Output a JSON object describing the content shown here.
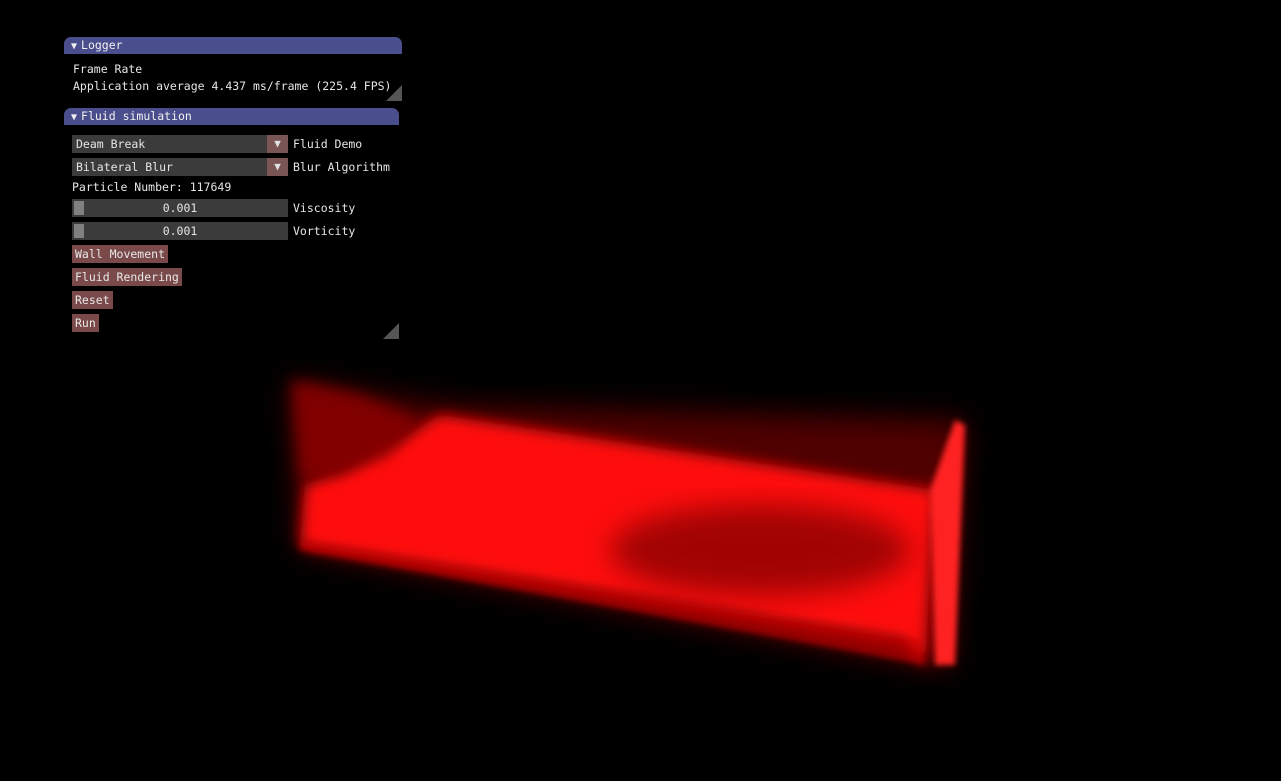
{
  "logger": {
    "title": "Logger",
    "frame_rate_label": "Frame Rate",
    "stats": "Application average 4.437 ms/frame (225.4 FPS)"
  },
  "fluid": {
    "title": "Fluid simulation",
    "demo": {
      "value": "Deam Break",
      "label": "Fluid Demo"
    },
    "blur": {
      "value": "Bilateral Blur",
      "label": "Blur Algorithm"
    },
    "particle_number": "Particle Number: 117649",
    "viscosity": {
      "value": "0.001",
      "label": "Viscosity",
      "fraction": 0.001
    },
    "vorticity": {
      "value": "0.001",
      "label": "Vorticity",
      "fraction": 0.001
    },
    "buttons": {
      "wall_movement": "Wall Movement",
      "fluid_rendering": "Fluid Rendering",
      "reset": "Reset",
      "run": "Run"
    }
  },
  "icons": {
    "collapse": "collapse-triangle-icon",
    "dropdown": "dropdown-arrow-icon",
    "resize": "resize-grip-icon"
  },
  "colors": {
    "background": "#000000",
    "title_bar": "#4a4e8c",
    "button": "#7a4a4a",
    "fluid": "#ff0000"
  }
}
